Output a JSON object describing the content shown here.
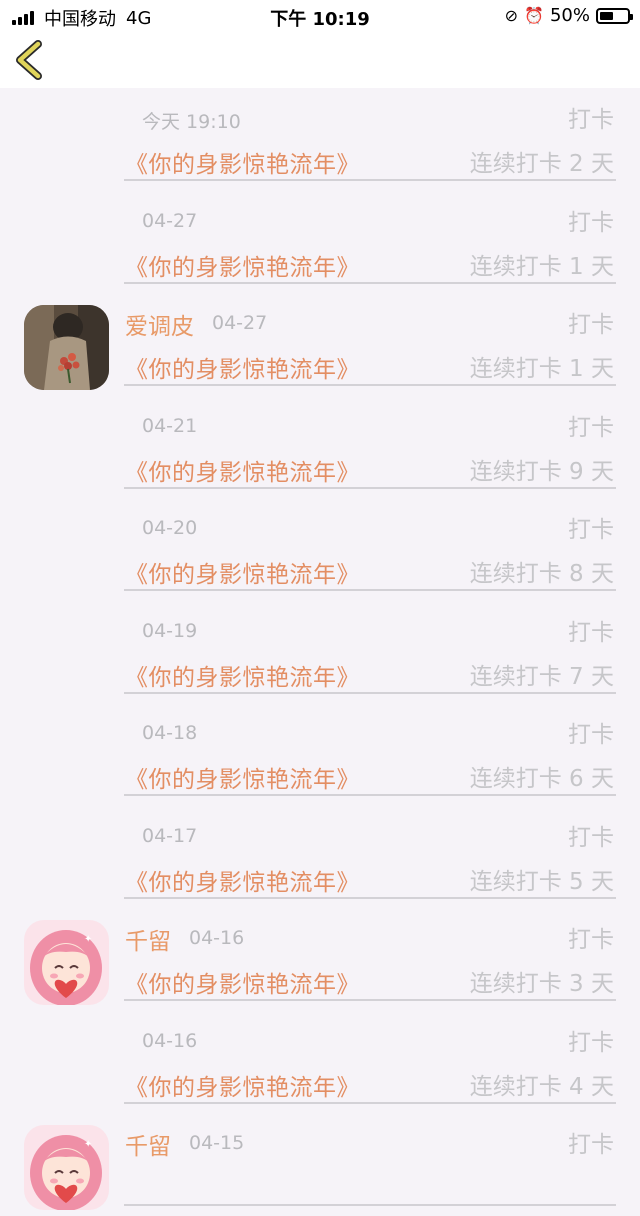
{
  "status_bar": {
    "carrier": "中国移动",
    "network": "4G",
    "time": "下午 10:19",
    "battery_percent": "50%",
    "battery_level": 0.5
  },
  "nav": {
    "back_icon": "chevron-left-icon",
    "accent": "#e0d45a"
  },
  "colors": {
    "title": "#e38e63",
    "muted": "#c6c6c9",
    "background": "#f6f3f8"
  },
  "records": [
    {
      "name": "",
      "date": "今天 19:10",
      "action": "打卡",
      "title": "《你的身影惊艳流年》",
      "streak": "连续打卡 2 天"
    },
    {
      "name": "",
      "date": "04-27",
      "action": "打卡",
      "title": "《你的身影惊艳流年》",
      "streak": "连续打卡 1 天"
    },
    {
      "name": "爱调皮",
      "date": "04-27",
      "action": "打卡",
      "title": "《你的身影惊艳流年》",
      "streak": "连续打卡 1 天",
      "avatar": "photo"
    },
    {
      "name": "",
      "date": "04-21",
      "action": "打卡",
      "title": "《你的身影惊艳流年》",
      "streak": "连续打卡 9 天"
    },
    {
      "name": "",
      "date": "04-20",
      "action": "打卡",
      "title": "《你的身影惊艳流年》",
      "streak": "连续打卡 8 天"
    },
    {
      "name": "",
      "date": "04-19",
      "action": "打卡",
      "title": "《你的身影惊艳流年》",
      "streak": "连续打卡 7 天"
    },
    {
      "name": "",
      "date": "04-18",
      "action": "打卡",
      "title": "《你的身影惊艳流年》",
      "streak": "连续打卡 6 天"
    },
    {
      "name": "",
      "date": "04-17",
      "action": "打卡",
      "title": "《你的身影惊艳流年》",
      "streak": "连续打卡 5 天"
    },
    {
      "name": "千留",
      "date": "04-16",
      "action": "打卡",
      "title": "《你的身影惊艳流年》",
      "streak": "连续打卡 3 天",
      "avatar": "anime"
    },
    {
      "name": "",
      "date": "04-16",
      "action": "打卡",
      "title": "《你的身影惊艳流年》",
      "streak": "连续打卡 4 天"
    },
    {
      "name": "千留",
      "date": "04-15",
      "action": "打卡",
      "title": "",
      "streak": "",
      "avatar": "anime"
    }
  ]
}
